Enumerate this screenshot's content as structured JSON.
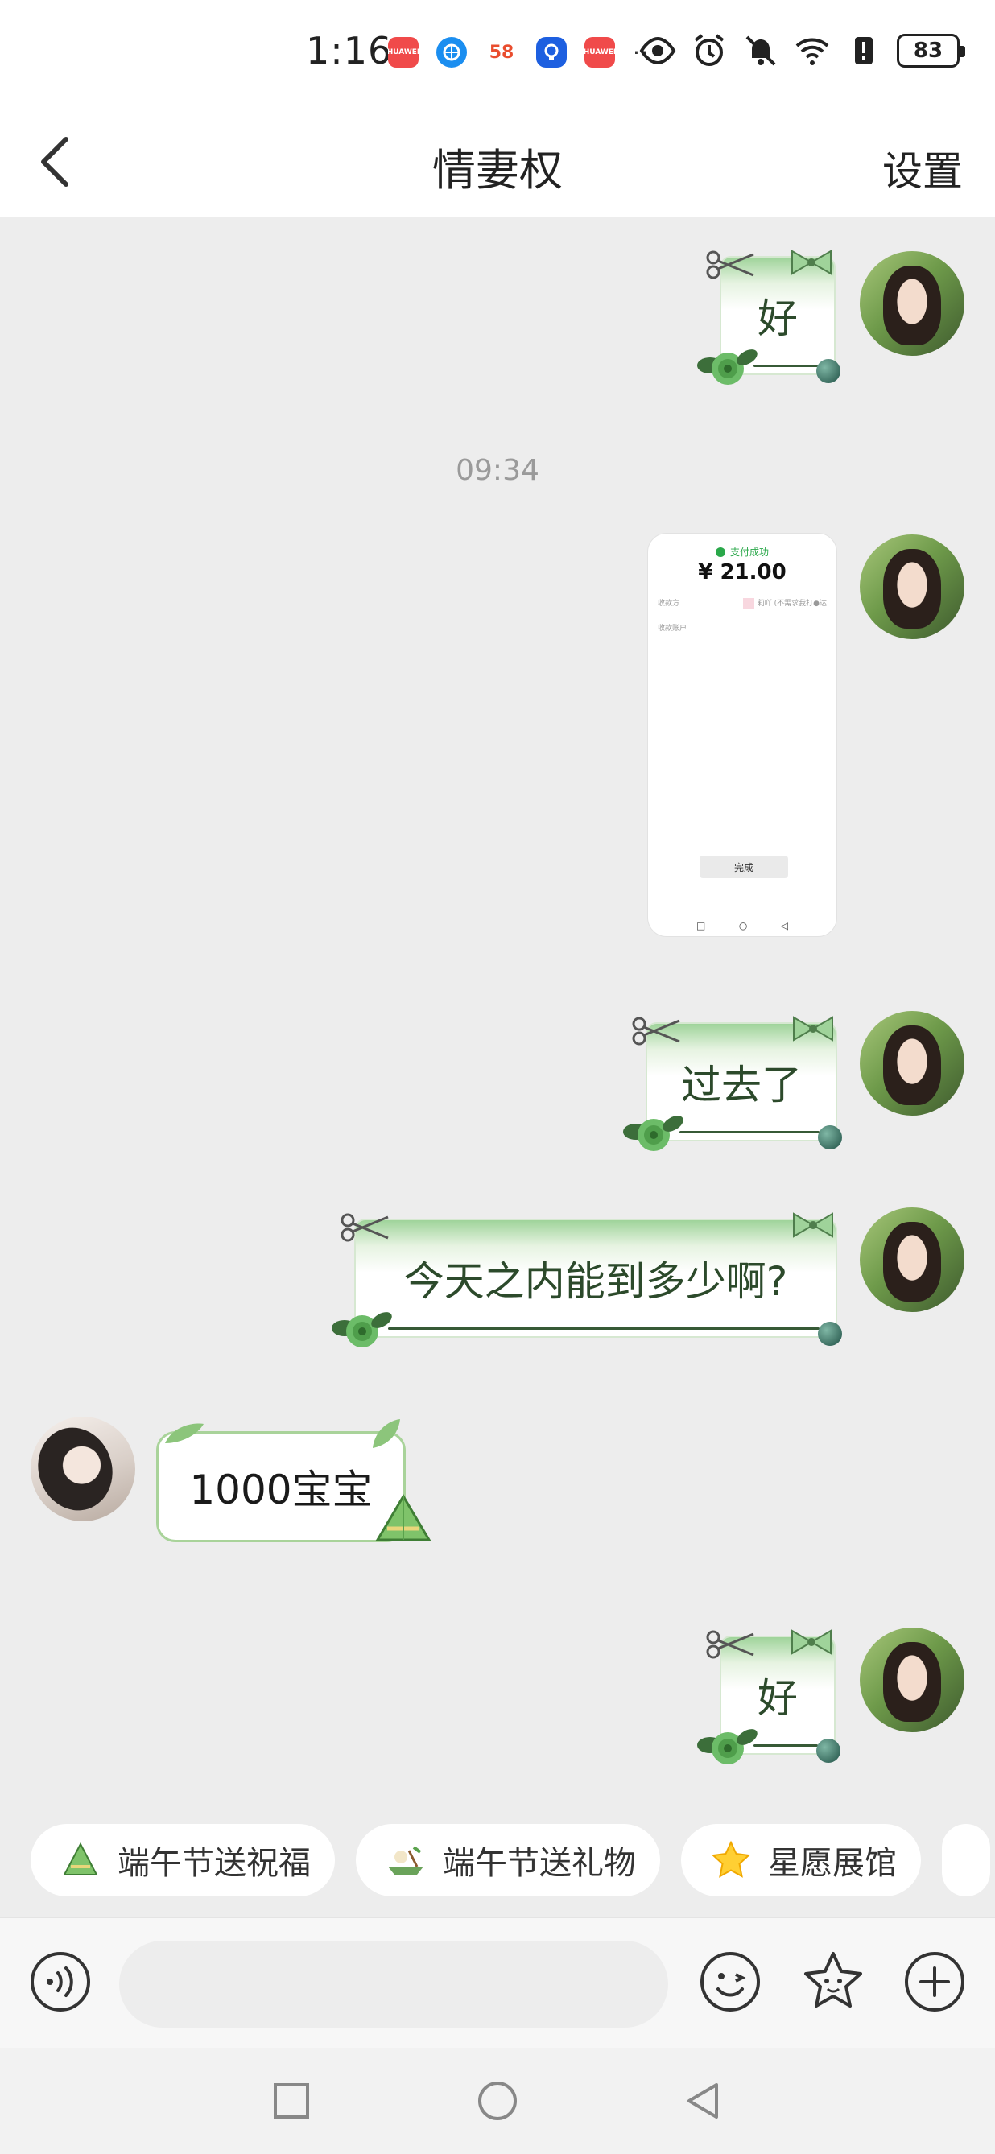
{
  "status_bar": {
    "time": "1:16",
    "notification_icons": [
      "huawei-appgallery-icon",
      "browser-icon",
      "58-app-icon",
      "lightbulb-app-icon",
      "huawei-appgallery-icon"
    ],
    "app_58_label": "58",
    "more": "···",
    "battery": "83"
  },
  "header": {
    "title": "情妻权",
    "settings_label": "设置"
  },
  "messages": {
    "m1_text": "好",
    "time_divider": "09:34",
    "image": {
      "success_text": "支付成功",
      "amount": "¥ 21.00",
      "row1_left": "收款方",
      "row1_right": "莉吖 (不需求我打●达",
      "row2_left": "收款账户",
      "done_label": "完成"
    },
    "m3_text": "过去了",
    "m4_text": "今天之内能到多少啊?",
    "m5_text": "1000宝宝",
    "m6_text": "好"
  },
  "quick_chips": [
    {
      "label": "端午节送祝福",
      "icon": "zongzi-icon"
    },
    {
      "label": "端午节送礼物",
      "icon": "dragon-boat-icon"
    },
    {
      "label": "星愿展馆",
      "icon": "star-icon"
    }
  ],
  "input": {
    "placeholder": "",
    "value": ""
  },
  "colors": {
    "accent_green": "#a9d39a",
    "dark_green_text": "#2c4a2b",
    "background": "#ededed"
  }
}
